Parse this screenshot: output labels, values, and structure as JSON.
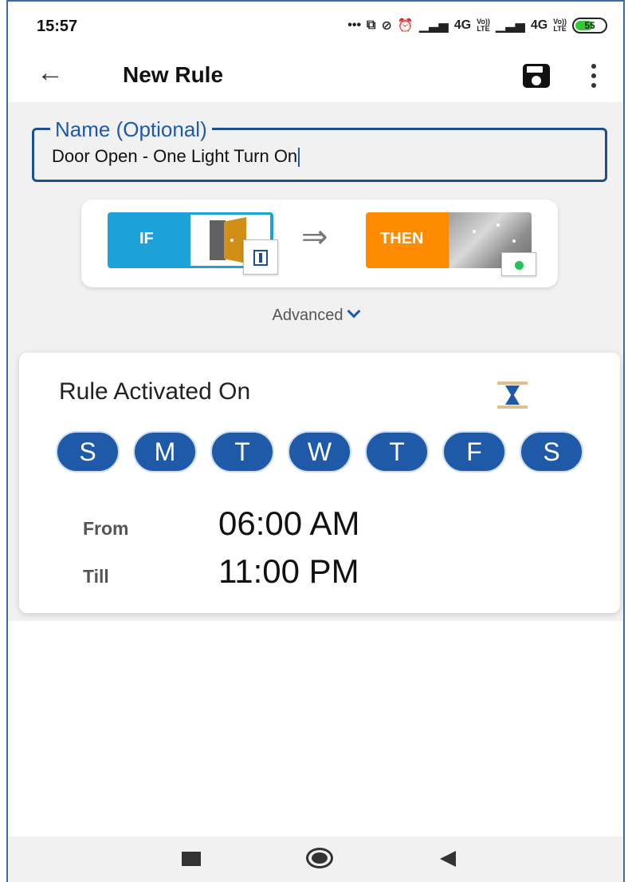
{
  "status_bar": {
    "time": "15:57",
    "dots": "•••",
    "network1": "4G",
    "volte1_top": "Vo))",
    "volte1_bottom": "LTE",
    "network2": "4G",
    "volte2_top": "Vo))",
    "volte2_bottom": "LTE",
    "battery": "55"
  },
  "app_bar": {
    "title": "New Rule"
  },
  "name_field": {
    "label": "Name (Optional)",
    "value": "Door Open - One Light Turn On"
  },
  "rule": {
    "if_label": "IF",
    "then_label": "THEN",
    "arrow": "⇒"
  },
  "advanced_label": "Advanced",
  "schedule": {
    "title": "Rule Activated On",
    "days": [
      "S",
      "M",
      "T",
      "W",
      "T",
      "F",
      "S"
    ],
    "from_label": "From",
    "from_time": "06:00 AM",
    "till_label": "Till",
    "till_time": "11:00 PM"
  },
  "colors": {
    "primary": "#1e5aa8",
    "if_box": "#1da1d9",
    "then_box": "#ff8c00",
    "battery": "#37c837"
  },
  "icons": [
    "back-arrow-icon",
    "save-icon",
    "more-vert-icon",
    "door-icon",
    "light-icon",
    "hourglass-icon",
    "chevron-down-icon",
    "recents-icon",
    "home-icon",
    "back-icon"
  ]
}
